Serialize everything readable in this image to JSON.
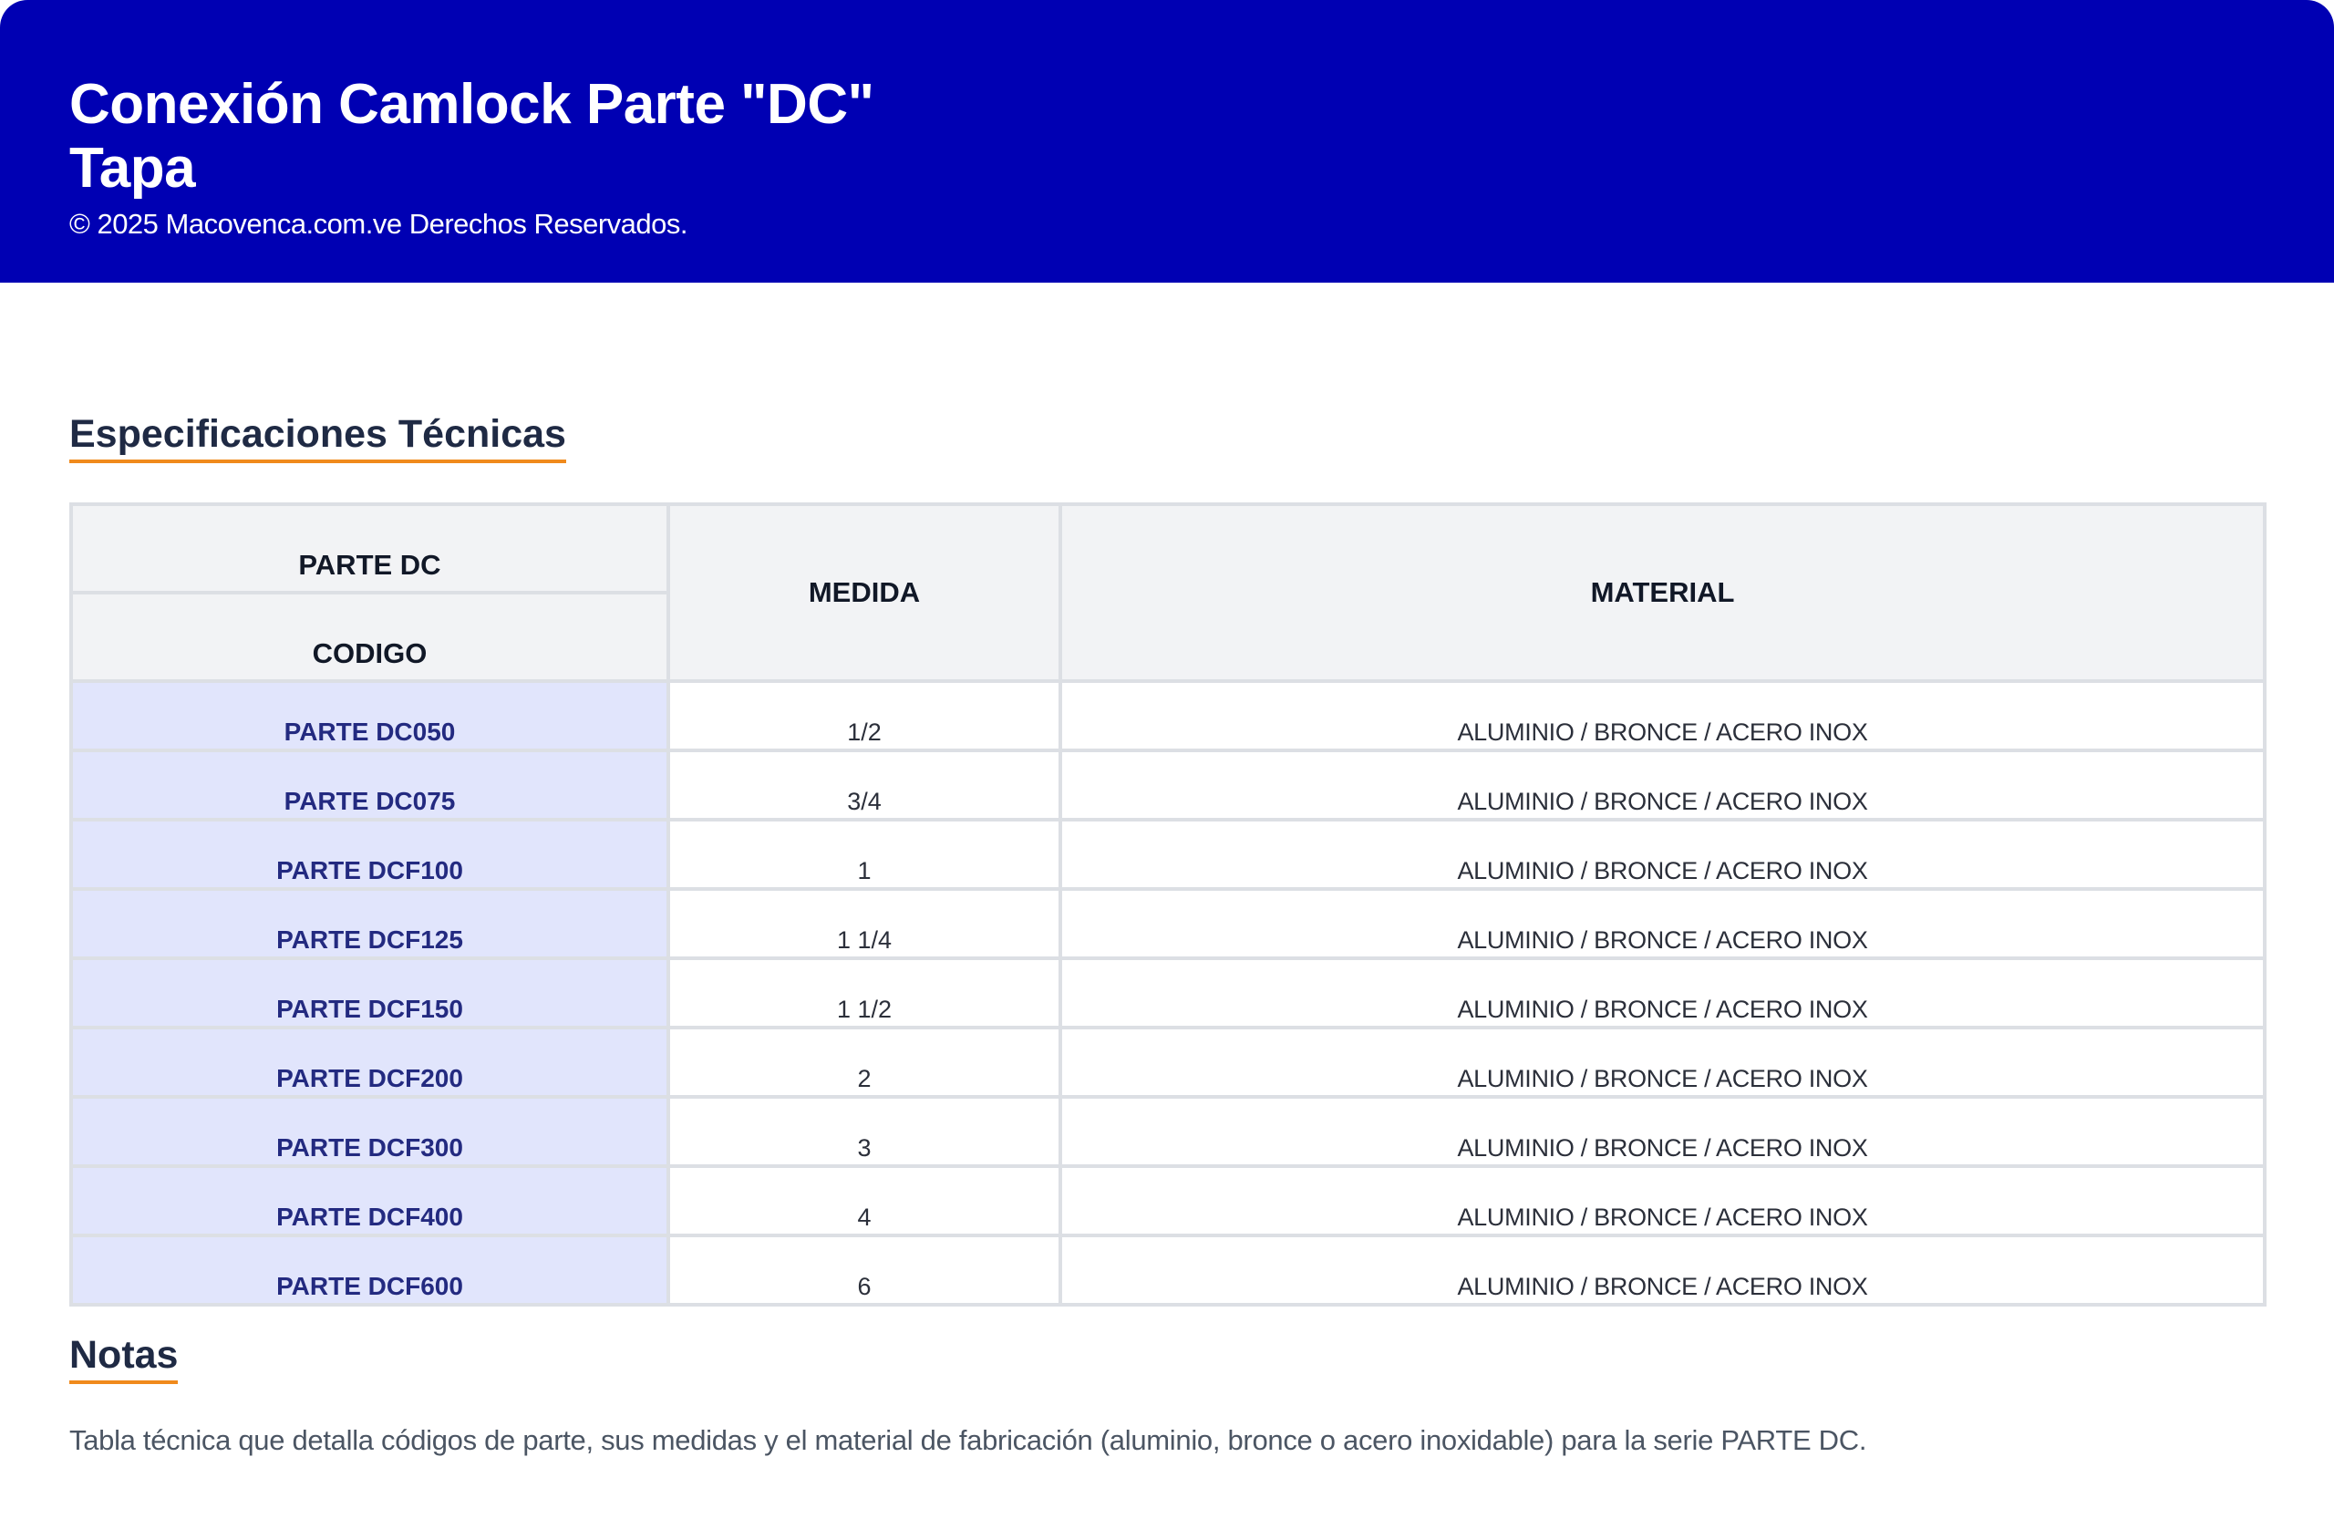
{
  "header": {
    "title_line1": "Conexión Camlock Parte \"DC\"",
    "title_line2": "Tapa",
    "copyright": "© 2025 Macovenca.com.ve Derechos Reservados."
  },
  "spec_section": {
    "title": "Especificaciones Técnicas"
  },
  "table": {
    "headers": {
      "part_group": "PARTE DC",
      "code": "CODIGO",
      "size": "MEDIDA",
      "material": "MATERIAL"
    },
    "rows": [
      {
        "code": "PARTE DC050",
        "size": "1/2",
        "material": "ALUMINIO / BRONCE / ACERO INOX"
      },
      {
        "code": "PARTE DC075",
        "size": "3/4",
        "material": "ALUMINIO / BRONCE / ACERO INOX"
      },
      {
        "code": "PARTE DCF100",
        "size": "1",
        "material": "ALUMINIO / BRONCE / ACERO INOX"
      },
      {
        "code": "PARTE DCF125",
        "size": "1 1/4",
        "material": "ALUMINIO / BRONCE / ACERO INOX"
      },
      {
        "code": "PARTE DCF150",
        "size": "1 1/2",
        "material": "ALUMINIO / BRONCE / ACERO INOX"
      },
      {
        "code": "PARTE DCF200",
        "size": "2",
        "material": "ALUMINIO / BRONCE / ACERO INOX"
      },
      {
        "code": "PARTE DCF300",
        "size": "3",
        "material": "ALUMINIO / BRONCE / ACERO INOX"
      },
      {
        "code": "PARTE DCF400",
        "size": "4",
        "material": "ALUMINIO / BRONCE / ACERO INOX"
      },
      {
        "code": "PARTE DCF600",
        "size": "6",
        "material": "ALUMINIO / BRONCE / ACERO INOX"
      }
    ]
  },
  "notes_section": {
    "title": "Notas",
    "text": "Tabla técnica que detalla códigos de parte, sus medidas y el material de fabricación (aluminio, bronce o acero inoxidable) para la serie PARTE DC."
  },
  "colors": {
    "header_bg": "#0000b3",
    "accent_underline": "#f08a1c",
    "code_cell_bg": "#e1e5fc",
    "code_text": "#232a80"
  }
}
